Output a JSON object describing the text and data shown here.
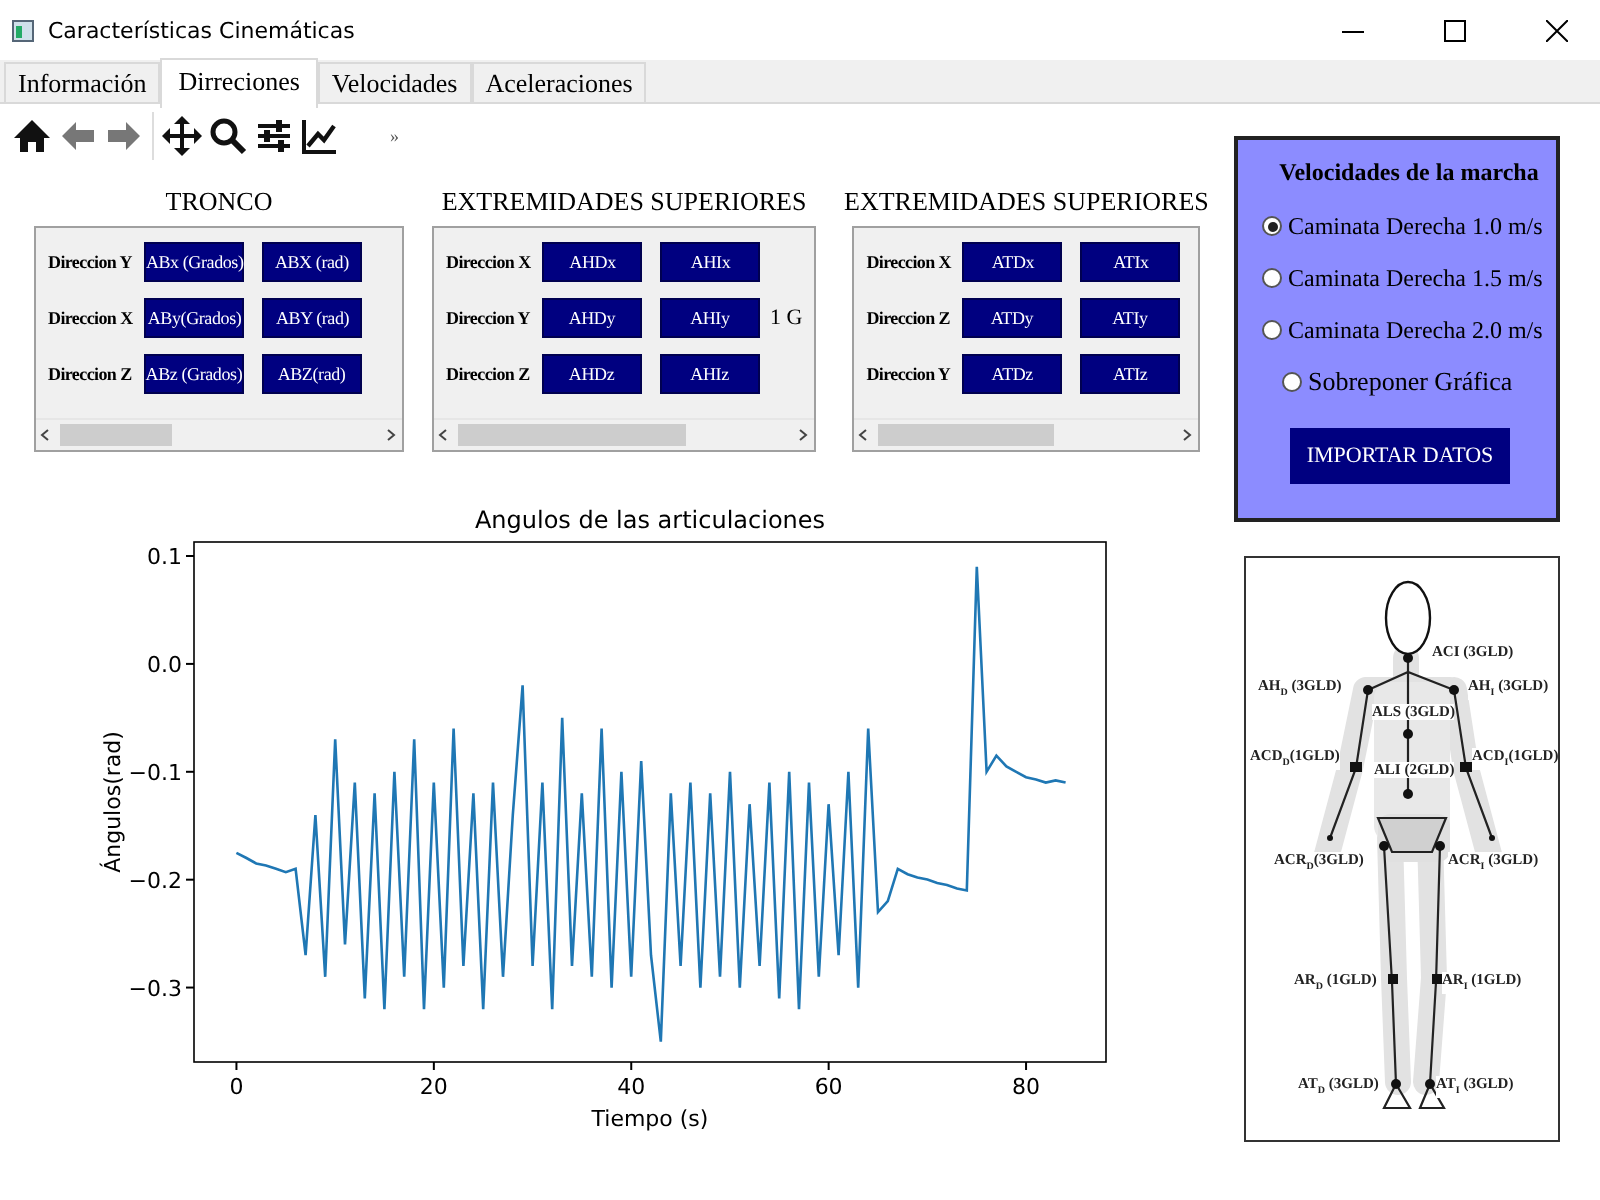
{
  "window": {
    "title": "Características Cinemáticas"
  },
  "tabs": [
    {
      "label": "Información",
      "selected": false
    },
    {
      "label": "Dirreciones",
      "selected": true
    },
    {
      "label": "Velocidades",
      "selected": false
    },
    {
      "label": "Aceleraciones",
      "selected": false
    }
  ],
  "toolbar": {
    "more": "»"
  },
  "groups": [
    {
      "title": "TRONCO",
      "rows": [
        {
          "label": "Direccion Y",
          "buttons": [
            "ABx (Grados)",
            "ABX (rad)"
          ]
        },
        {
          "label": "Direccion X",
          "buttons": [
            "ABy(Grados)",
            "ABY (rad)"
          ]
        },
        {
          "label": "Direccion Z",
          "buttons": [
            "ABz (Grados)",
            "ABZ(rad)"
          ]
        }
      ]
    },
    {
      "title": "EXTREMIDADES SUPERIORES",
      "rows": [
        {
          "label": "Direccion X",
          "buttons": [
            "AHDx",
            "AHIx"
          ]
        },
        {
          "label": "Direccion Y",
          "buttons": [
            "AHDy",
            "AHIy"
          ],
          "extra": "1 G"
        },
        {
          "label": "Direccion Z",
          "buttons": [
            "AHDz",
            "AHIz"
          ]
        }
      ]
    },
    {
      "title": "EXTREMIDADES SUPERIORES",
      "rows": [
        {
          "label": "Direccion X",
          "buttons": [
            "ATDx",
            "ATIx"
          ]
        },
        {
          "label": "Direccion Z",
          "buttons": [
            "ATDy",
            "ATIy"
          ]
        },
        {
          "label": "Direccion Y",
          "buttons": [
            "ATDz",
            "ATIz"
          ]
        }
      ]
    }
  ],
  "chart": {
    "chart_data": {
      "type": "line",
      "title": "Angulos de las articulaciones",
      "xlabel": "Tiempo (s)",
      "ylabel": "Ángulos(rad)",
      "x": [
        0,
        1,
        2,
        3,
        4,
        5,
        6,
        7,
        8,
        9,
        10,
        11,
        12,
        13,
        14,
        15,
        16,
        17,
        18,
        19,
        20,
        21,
        22,
        23,
        24,
        25,
        26,
        27,
        28,
        29,
        30,
        31,
        32,
        33,
        34,
        35,
        36,
        37,
        38,
        39,
        40,
        41,
        42,
        43,
        44,
        45,
        46,
        47,
        48,
        49,
        50,
        51,
        52,
        53,
        54,
        55,
        56,
        57,
        58,
        59,
        60,
        61,
        62,
        63,
        64,
        65,
        66,
        67,
        68,
        69,
        70,
        71,
        72,
        73,
        74,
        75,
        76,
        77,
        78,
        79,
        80,
        81,
        82,
        83,
        84
      ],
      "series": [
        {
          "color": "#1f77b4",
          "values": [
            -0.175,
            -0.18,
            -0.185,
            -0.187,
            -0.19,
            -0.193,
            -0.19,
            -0.27,
            -0.14,
            -0.29,
            -0.07,
            -0.26,
            -0.11,
            -0.31,
            -0.12,
            -0.32,
            -0.1,
            -0.29,
            -0.07,
            -0.32,
            -0.11,
            -0.3,
            -0.06,
            -0.28,
            -0.12,
            -0.32,
            -0.11,
            -0.29,
            -0.14,
            -0.02,
            -0.28,
            -0.11,
            -0.32,
            -0.05,
            -0.28,
            -0.12,
            -0.29,
            -0.06,
            -0.3,
            -0.1,
            -0.29,
            -0.09,
            -0.27,
            -0.35,
            -0.12,
            -0.28,
            -0.11,
            -0.3,
            -0.12,
            -0.29,
            -0.1,
            -0.3,
            -0.13,
            -0.28,
            -0.11,
            -0.31,
            -0.1,
            -0.32,
            -0.11,
            -0.29,
            -0.13,
            -0.27,
            -0.1,
            -0.3,
            -0.06,
            -0.23,
            -0.22,
            -0.19,
            -0.195,
            -0.198,
            -0.2,
            -0.203,
            -0.205,
            -0.208,
            -0.21,
            0.09,
            -0.1,
            -0.085,
            -0.095,
            -0.1,
            -0.105,
            -0.107,
            -0.11,
            -0.108,
            -0.11
          ]
        }
      ],
      "xlim": [
        -4.3,
        88.1
      ],
      "ylim": [
        -0.369,
        0.113
      ],
      "xticks": [
        0,
        20,
        40,
        60,
        80
      ],
      "yticks": [
        {
          "value": 0.1,
          "label": "0.1"
        },
        {
          "value": 0,
          "label": "0.0"
        },
        {
          "value": -0.1,
          "label": "−0.1"
        },
        {
          "value": -0.2,
          "label": "−0.2"
        },
        {
          "value": -0.3,
          "label": "−0.3"
        }
      ]
    }
  },
  "speed_panel": {
    "title": "Velocidades de la marcha",
    "options": [
      {
        "label": "Caminata Derecha 1.0 m/s",
        "selected": true
      },
      {
        "label": "Caminata Derecha 1.5 m/s",
        "selected": false
      },
      {
        "label": "Caminata Derecha 2.0 m/s",
        "selected": false
      }
    ],
    "overlay": {
      "label": "Sobreponer Gráfica",
      "selected": false
    },
    "button": "IMPORTAR DATOS"
  },
  "body_figure": {
    "labels": [
      "ACI (3GLD)",
      "AH$_{D}$ (3GLD)",
      "AH$_{I}$ (3GLD)",
      "ALS (3GLD)",
      "ACD$_{D}$(1GLD)",
      "ACD$_{I}$(1GLD)",
      "ALI (2GLD)",
      "ACR$_{D}$(3GLD)",
      "ACR$_{I}$ (3GLD)",
      "AR$_{D}$ (1GLD)",
      "AR$_{I}$ (1GLD)",
      "AT$_{D}$ (3GLD)",
      "AT$_{I}$ (3GLD)"
    ]
  }
}
